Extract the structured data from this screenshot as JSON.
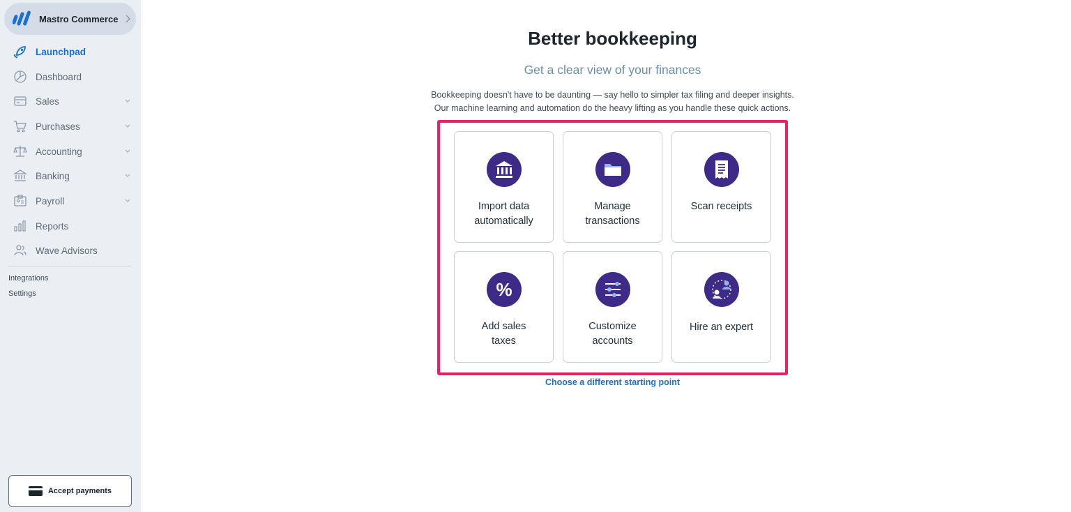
{
  "sidebar": {
    "business_name": "Mastro Commerce",
    "items": [
      {
        "label": "Launchpad",
        "icon": "rocket-icon",
        "active": true,
        "expandable": false
      },
      {
        "label": "Dashboard",
        "icon": "dashboard-icon",
        "active": false,
        "expandable": false
      },
      {
        "label": "Sales",
        "icon": "sales-icon",
        "active": false,
        "expandable": true
      },
      {
        "label": "Purchases",
        "icon": "cart-icon",
        "active": false,
        "expandable": true
      },
      {
        "label": "Accounting",
        "icon": "scale-icon",
        "active": false,
        "expandable": true
      },
      {
        "label": "Banking",
        "icon": "bank-icon",
        "active": false,
        "expandable": true
      },
      {
        "label": "Payroll",
        "icon": "payroll-icon",
        "active": false,
        "expandable": true
      },
      {
        "label": "Reports",
        "icon": "reports-icon",
        "active": false,
        "expandable": false
      },
      {
        "label": "Wave Advisors",
        "icon": "advisors-icon",
        "active": false,
        "expandable": false
      }
    ],
    "links": [
      "Integrations",
      "Settings"
    ],
    "accept_payments_label": "Accept payments"
  },
  "main": {
    "title": "Better bookkeeping",
    "subtitle": "Get a clear view of your finances",
    "description_line1": "Bookkeeping doesn't have to be daunting — say hello to simpler tax filing and deeper insights.",
    "description_line2": "Our machine learning and automation do the heavy lifting as you handle these quick actions.",
    "cards": [
      {
        "line1": "Import data",
        "line2": "automatically",
        "icon": "bank-icon"
      },
      {
        "line1": "Manage",
        "line2": "transactions",
        "icon": "folder-icon"
      },
      {
        "line1": "Scan receipts",
        "line2": "",
        "icon": "receipt-icon"
      },
      {
        "line1": "Add sales",
        "line2": "taxes",
        "icon": "percent-icon"
      },
      {
        "line1": "Customize",
        "line2": "accounts",
        "icon": "sliders-icon"
      },
      {
        "line1": "Hire an expert",
        "line2": "",
        "icon": "expert-icon"
      }
    ],
    "choose_link": "Choose a different starting point"
  },
  "colors": {
    "accent": "#1c6fd1",
    "icon_circle": "#3e2a87",
    "highlight": "#ee1f5e",
    "sidebar_bg": "#ebeff4"
  }
}
